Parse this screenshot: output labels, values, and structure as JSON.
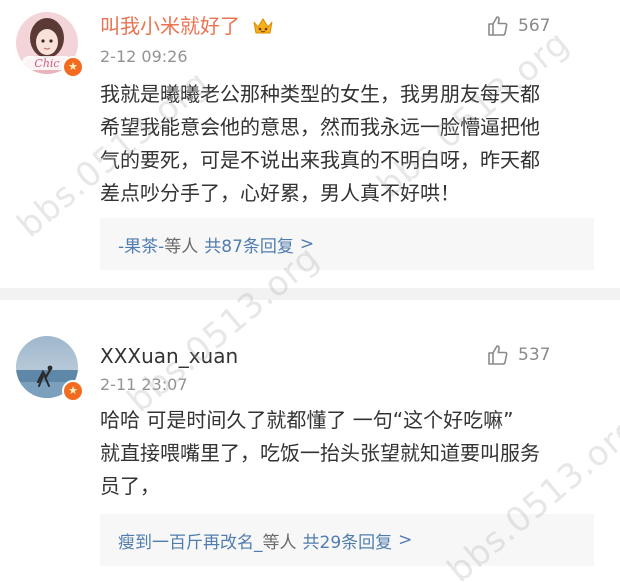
{
  "comments": [
    {
      "username": "叫我小米就好了",
      "avatar_label": "Chic",
      "time": "2-12 09:26",
      "likes": "567",
      "text_lines": [
        "我就是曦曦老公那种类型的女生，我男朋友每天都",
        "希望我能意会他的意思，然而我永远一脸懵逼把他",
        "气的要死，可是不说出来我真的不明白呀，昨天都",
        "差点吵分手了，心好累，男人真不好哄！"
      ],
      "reply": {
        "user": "-果茶-",
        "suffix": "等人",
        "count": "共87条回复",
        "chevron": ">"
      }
    },
    {
      "username": "XXXuan_xuan",
      "time": "2-11 23:07",
      "likes": "537",
      "text_lines": [
        "哈哈 可是时间久了就都懂了 一句“这个好吃嘛”",
        "就直接喂嘴里了，吃饭一抬头张望就知道要叫服务",
        "员了，"
      ],
      "reply": {
        "user": "瘦到一百斤再改名_",
        "suffix": "等人",
        "count": "共29条回复",
        "chevron": ">"
      }
    }
  ],
  "watermark": "bbs.0513.org",
  "colors": {
    "vip_name": "#eb7350",
    "link": "#507daf",
    "badge": "#f36b21"
  }
}
